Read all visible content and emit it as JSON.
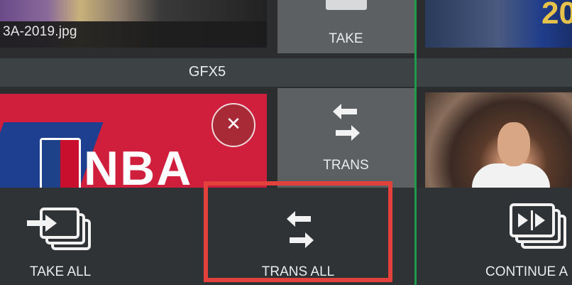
{
  "top_row": {
    "left_thumbnail": {
      "filename": "3A-2019.jpg"
    },
    "take_button": {
      "label": "TAKE",
      "icon": "take-icon"
    },
    "right_thumbnail": {
      "jersey_number": "20"
    }
  },
  "group_label": "GFX5",
  "middle_row": {
    "left_thumbnail": {
      "logo_text": "NBA",
      "close_icon": "close-icon"
    },
    "trans_button": {
      "label": "TRANS",
      "icon": "swap-arrows-icon"
    }
  },
  "bottom_bar": {
    "take_all": {
      "label": "TAKE ALL",
      "icon": "stacked-take-icon"
    },
    "trans_all": {
      "label": "TRANS ALL",
      "icon": "swap-arrows-icon",
      "highlighted": true
    },
    "continue_all": {
      "label": "CONTINUE A",
      "icon": "stacked-continue-icon"
    }
  },
  "colors": {
    "background": "#2b2d2f",
    "button": "#5c6063",
    "band": "#3d4245",
    "highlight": "#e3413b",
    "program_line": "#1e9a49"
  }
}
